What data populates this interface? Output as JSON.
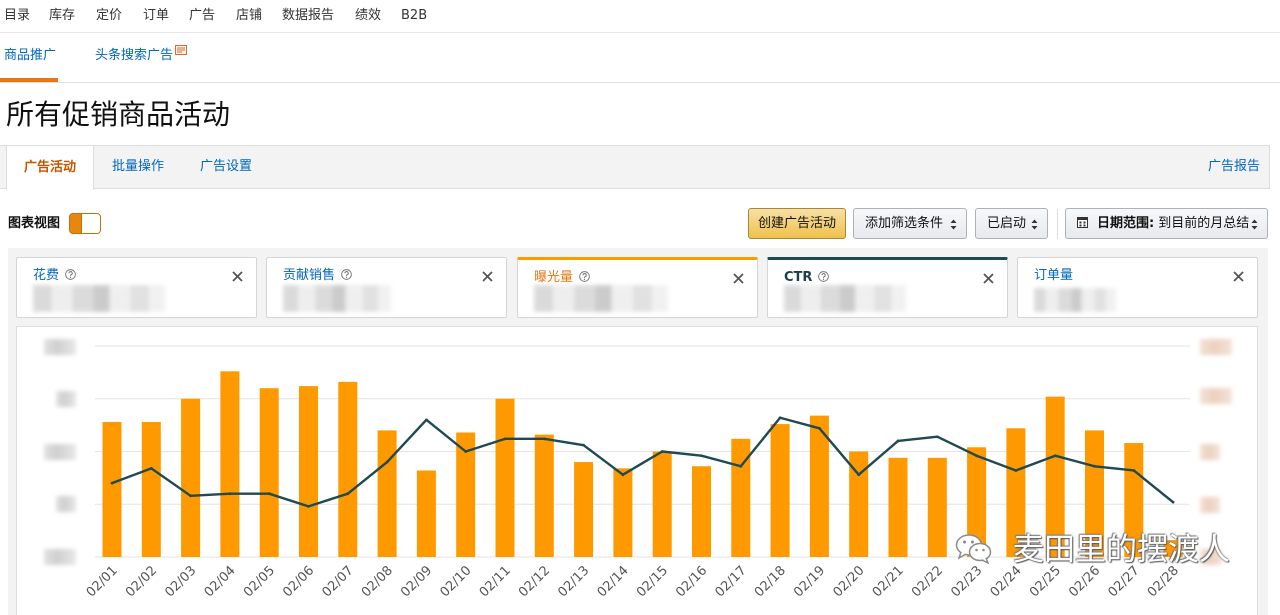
{
  "top_nav": {
    "items": [
      "目录",
      "库存",
      "定价",
      "订单",
      "广告",
      "店铺",
      "数据报告",
      "绩效",
      "B2B"
    ]
  },
  "sub_nav": {
    "tabs": [
      {
        "label": "商品推广",
        "active": true
      },
      {
        "label": "头条搜索广告",
        "active": false,
        "badge_icon": "new-badge-icon"
      }
    ]
  },
  "page": {
    "title": "所有促销商品活动"
  },
  "page_tabs": {
    "items": [
      {
        "label": "广告活动",
        "active": true
      },
      {
        "label": "批量操作",
        "active": false
      },
      {
        "label": "广告设置",
        "active": false
      }
    ],
    "report_link": "广告报告"
  },
  "toolbar": {
    "chart_view_label": "图表视图",
    "chart_view_on": true,
    "create_campaign_button": "创建广告活动",
    "add_filter_dropdown": "添加筛选条件",
    "status_dropdown": "已启动",
    "date_range": {
      "icon": "calendar-icon",
      "label": "日期范围:",
      "value": "到目前的月总结"
    }
  },
  "metric_cards": [
    {
      "label": "花费",
      "help_icon": "question-circle-icon",
      "selected": false,
      "color": null
    },
    {
      "label": "贡献销售",
      "help_icon": "question-circle-icon",
      "selected": false,
      "color": null
    },
    {
      "label": "曝光量",
      "help_icon": "question-circle-icon",
      "selected": true,
      "color": "#ff9900"
    },
    {
      "label": "CTR",
      "help_icon": "question-circle-icon",
      "selected": true,
      "color": "#1f4a52"
    },
    {
      "label": "订单量",
      "help_icon": null,
      "selected": false,
      "color": null
    }
  ],
  "colors": {
    "link": "#0066c0",
    "active_tab_text": "#c45500",
    "accent_orange": "#ff9900",
    "dark_series": "#1f4a52",
    "create_button": "#f0c14b"
  },
  "chart_data": {
    "type": "bar",
    "categories": [
      "02/01",
      "02/02",
      "02/03",
      "02/04",
      "02/05",
      "02/06",
      "02/07",
      "02/08",
      "02/09",
      "02/10",
      "02/11",
      "02/12",
      "02/13",
      "02/14",
      "02/15",
      "02/16",
      "02/17",
      "02/18",
      "02/19",
      "02/20",
      "02/21",
      "02/22",
      "02/23",
      "02/24",
      "02/25",
      "02/26",
      "02/27",
      "02/28"
    ],
    "series": [
      {
        "type": "bar",
        "color": "#ff9900",
        "axis": "right",
        "values": [
          0.64,
          0.64,
          0.75,
          0.88,
          0.8,
          0.81,
          0.83,
          0.6,
          0.41,
          0.59,
          0.75,
          0.58,
          0.45,
          0.42,
          0.5,
          0.43,
          0.56,
          0.63,
          0.67,
          0.5,
          0.47,
          0.47,
          0.52,
          0.61,
          0.76,
          0.6,
          0.54,
          0.08
        ]
      },
      {
        "type": "line",
        "color": "#1f4a52",
        "axis": "left",
        "values": [
          0.35,
          0.42,
          0.29,
          0.3,
          0.3,
          0.24,
          0.3,
          0.45,
          0.65,
          0.5,
          0.56,
          0.56,
          0.53,
          0.39,
          0.5,
          0.48,
          0.43,
          0.66,
          0.61,
          0.39,
          0.55,
          0.57,
          0.48,
          0.41,
          0.48,
          0.43,
          0.41,
          0.26
        ]
      }
    ],
    "ylim": [
      0,
      1
    ],
    "grid": true,
    "y_axis_labels_blurred": true
  },
  "watermark": {
    "icon": "wechat-icon",
    "text": "麦田里的摆渡人"
  }
}
